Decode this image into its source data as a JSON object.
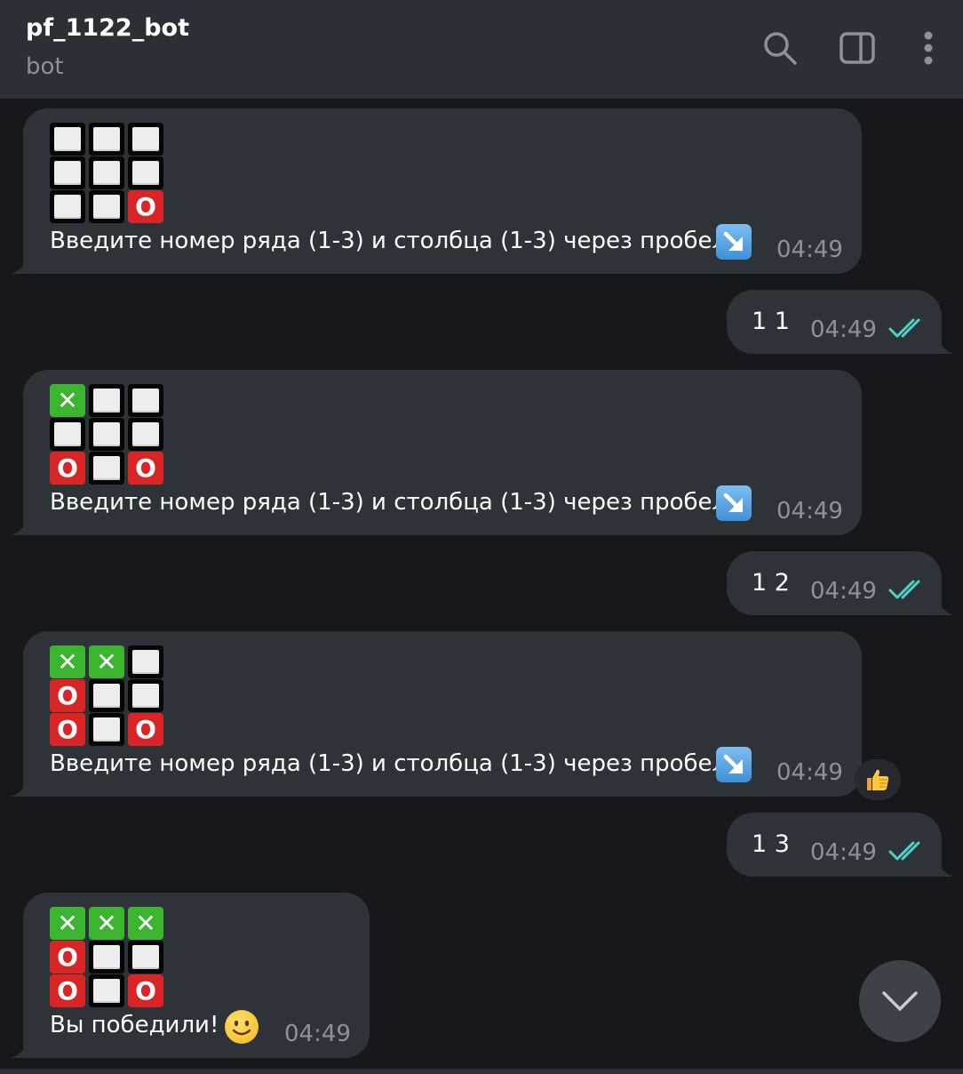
{
  "header": {
    "title": "pf_1122_bot",
    "subtitle": "bot",
    "icons": [
      "search-icon",
      "sidebar-toggle-icon",
      "more-vertical-icon"
    ]
  },
  "messages": [
    {
      "direction": "incoming",
      "board": [
        [
          "e",
          "e",
          "e"
        ],
        [
          "e",
          "e",
          "e"
        ],
        [
          "e",
          "e",
          "o"
        ]
      ],
      "text": "Введите номер ряда (1-3) и столбца (1-3) через пробел",
      "emoji": "arrow-down-right-icon",
      "time": "04:49"
    },
    {
      "direction": "outgoing",
      "text": "1 1",
      "time": "04:49",
      "status": "read"
    },
    {
      "direction": "incoming",
      "board": [
        [
          "x",
          "e",
          "e"
        ],
        [
          "e",
          "e",
          "e"
        ],
        [
          "o",
          "e",
          "o"
        ]
      ],
      "text": "Введите номер ряда (1-3) и столбца (1-3) через пробел",
      "emoji": "arrow-down-right-icon",
      "time": "04:49"
    },
    {
      "direction": "outgoing",
      "text": "1 2",
      "time": "04:49",
      "status": "read"
    },
    {
      "direction": "incoming",
      "board": [
        [
          "x",
          "x",
          "e"
        ],
        [
          "o",
          "e",
          "e"
        ],
        [
          "o",
          "e",
          "o"
        ]
      ],
      "text": "Введите номер ряда (1-3) и столбца (1-3) через пробел",
      "emoji": "arrow-down-right-icon",
      "time": "04:49",
      "reaction": "thumbs-up-icon"
    },
    {
      "direction": "outgoing",
      "text": "1 3",
      "time": "04:49",
      "status": "read"
    },
    {
      "direction": "incoming",
      "board": [
        [
          "x",
          "x",
          "x"
        ],
        [
          "o",
          "e",
          "e"
        ],
        [
          "o",
          "e",
          "o"
        ]
      ],
      "text": "Вы победили!",
      "emoji": "smiling-face-icon",
      "time": "04:49"
    }
  ],
  "cell_symbols": {
    "x": "✕",
    "o": "O",
    "e": ""
  },
  "colors": {
    "background": "#17181c",
    "header": "#2b2f36",
    "bubble": "#2e3239",
    "read_check": "#4fd1c5",
    "x_cell": "#3bb52f",
    "o_cell": "#d92526"
  }
}
